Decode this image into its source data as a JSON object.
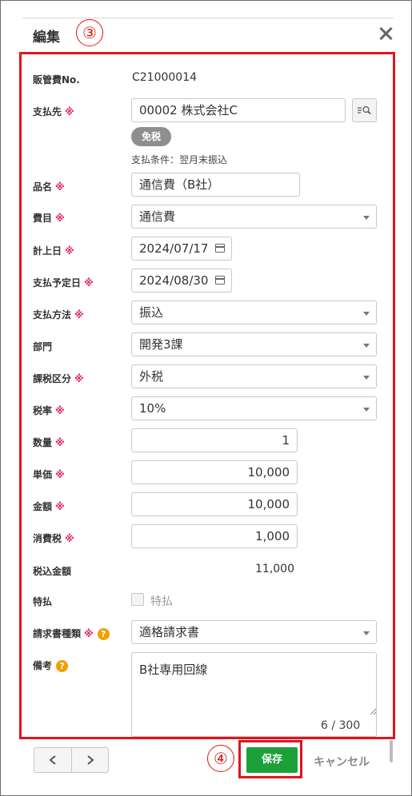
{
  "dialog": {
    "title": "編集"
  },
  "annotations": {
    "step3": "③",
    "step4": "④"
  },
  "fields": {
    "expense_no": {
      "label": "販管費No.",
      "value": "C21000014"
    },
    "payee": {
      "label": "支払先",
      "value": "00002 株式会社C",
      "badge": "免税",
      "payment_terms": "支払条件：翌月末振込"
    },
    "item_name": {
      "label": "品名",
      "value": "通信費（B社）"
    },
    "expense_item": {
      "label": "費目",
      "value": "通信費"
    },
    "posting_date": {
      "label": "計上日",
      "value": "2024/07/17"
    },
    "payment_due_date": {
      "label": "支払予定日",
      "value": "2024/08/30"
    },
    "payment_method": {
      "label": "支払方法",
      "value": "振込"
    },
    "department": {
      "label": "部門",
      "value": "開発3課"
    },
    "tax_category": {
      "label": "課税区分",
      "value": "外税"
    },
    "tax_rate": {
      "label": "税率",
      "value": "10%"
    },
    "quantity": {
      "label": "数量",
      "value": "1"
    },
    "unit_price": {
      "label": "単価",
      "value": "10,000"
    },
    "amount": {
      "label": "金額",
      "value": "10,000"
    },
    "consumption_tax": {
      "label": "消費税",
      "value": "1,000"
    },
    "tax_included_amount": {
      "label": "税込金額",
      "value": "11,000"
    },
    "special_payment": {
      "label": "特払",
      "checkbox_label": "特払",
      "checked": false
    },
    "invoice_type": {
      "label": "請求書種類",
      "value": "適格請求書"
    },
    "remarks": {
      "label": "備考",
      "value": "B社専用回線",
      "counter": "6 / 300"
    }
  },
  "required_mark": "※",
  "help_mark": "?",
  "footer": {
    "save_label": "保存",
    "cancel_label": "キャンセル"
  },
  "colors": {
    "save": "#1ba13a",
    "highlight": "#e0141e",
    "required": "#e0245e",
    "help": "#f0a000"
  }
}
